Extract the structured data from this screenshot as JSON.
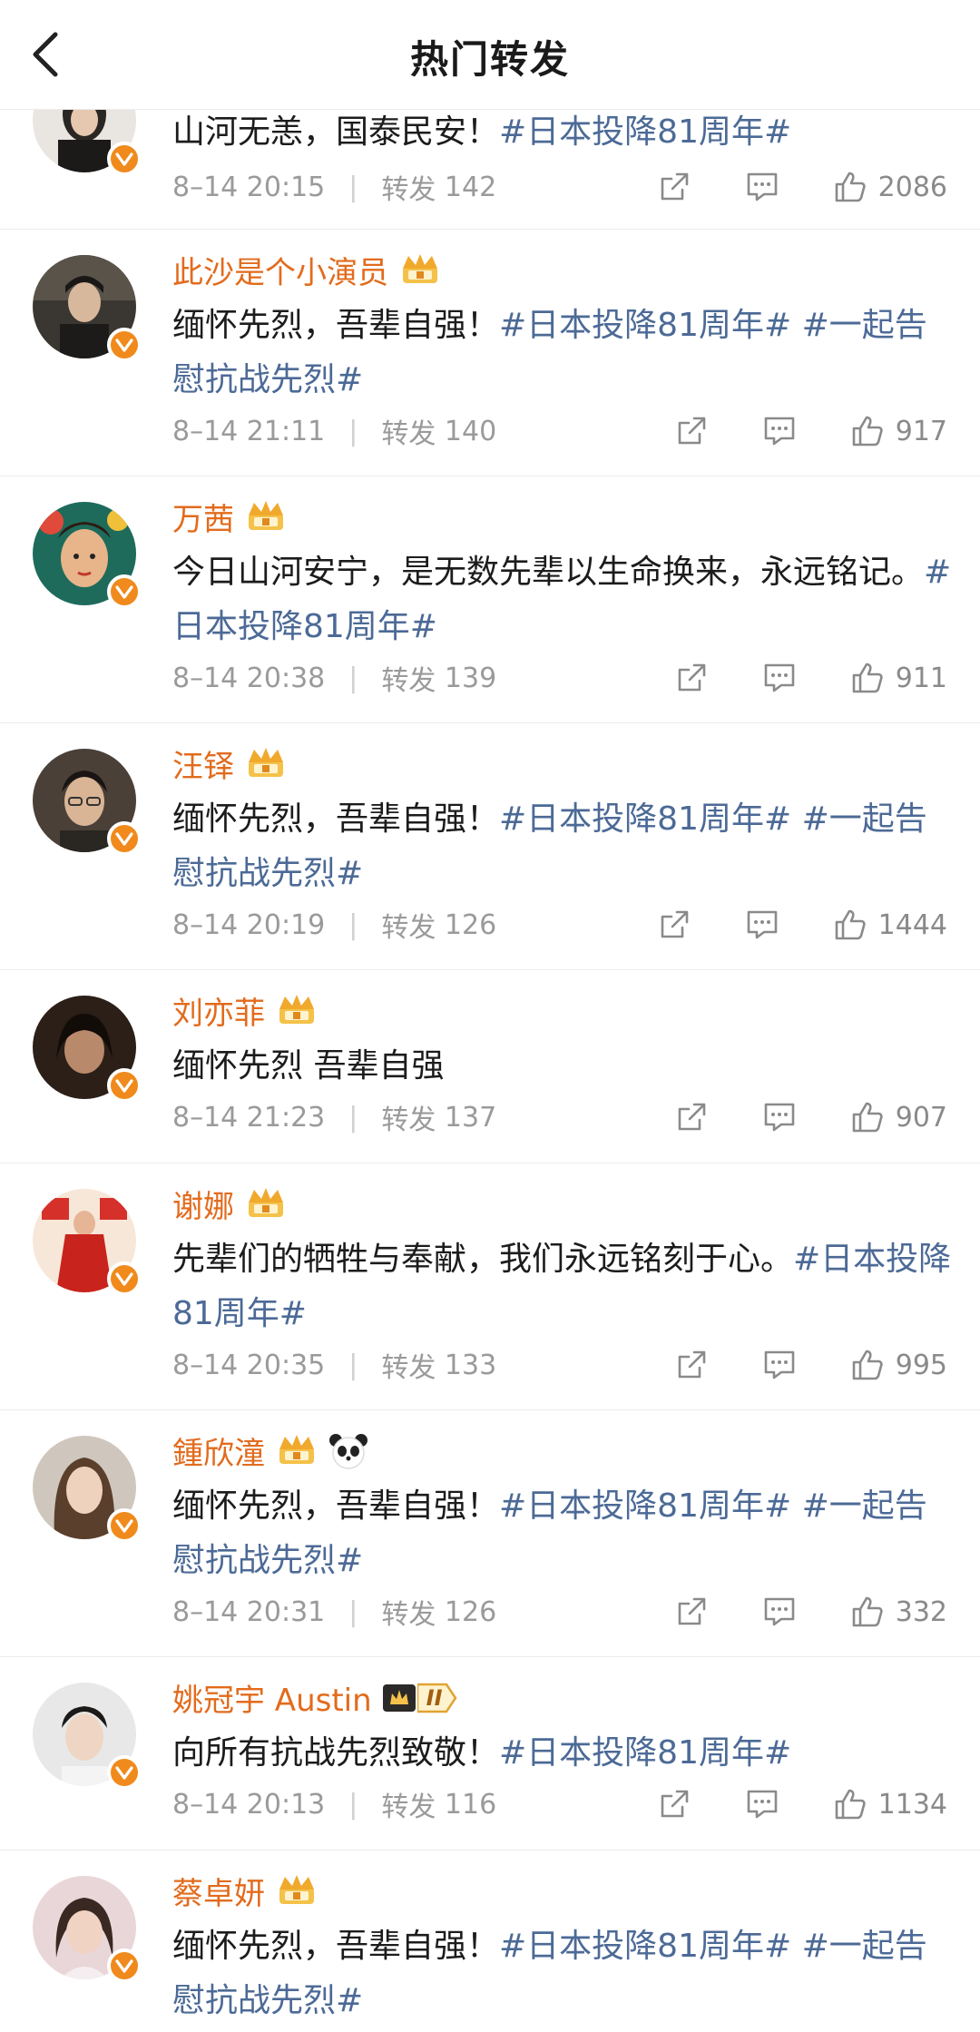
{
  "header": {
    "title": "热门转发"
  },
  "posts": [
    {
      "name": "",
      "badges": [],
      "text": "山河无恙，国泰民安！",
      "tags": "#日本投降81周年#",
      "time": "8–14 20:15",
      "repost_label": "转发",
      "repost_count": "142",
      "likes": "2086"
    },
    {
      "name": "此沙是个小演员",
      "badges": [
        "crown"
      ],
      "text": "缅怀先烈，吾辈自强！",
      "tags": "#日本投降81周年# #一起告慰抗战先烈#",
      "time": "8–14 21:11",
      "repost_label": "转发",
      "repost_count": "140",
      "likes": "917"
    },
    {
      "name": "万茜",
      "badges": [
        "crown"
      ],
      "text": "今日山河安宁，是无数先辈以生命换来，永远铭记。",
      "tags": "#日本投降81周年#",
      "time": "8–14 20:38",
      "repost_label": "转发",
      "repost_count": "139",
      "likes": "911"
    },
    {
      "name": "汪铎",
      "badges": [
        "crown"
      ],
      "text": "缅怀先烈，吾辈自强！",
      "tags": "#日本投降81周年# #一起告慰抗战先烈#",
      "time": "8–14 20:19",
      "repost_label": "转发",
      "repost_count": "126",
      "likes": "1444"
    },
    {
      "name": "刘亦菲",
      "badges": [
        "crown"
      ],
      "text": "缅怀先烈 吾辈自强",
      "tags": "",
      "time": "8–14 21:23",
      "repost_label": "转发",
      "repost_count": "137",
      "likes": "907"
    },
    {
      "name": "谢娜",
      "badges": [
        "crown"
      ],
      "text": "先辈们的牺牲与奉献，我们永远铭刻于心。",
      "tags": "#日本投降81周年#",
      "time": "8–14 20:35",
      "repost_label": "转发",
      "repost_count": "133",
      "likes": "995"
    },
    {
      "name": "鍾欣潼",
      "badges": [
        "crown",
        "panda"
      ],
      "text": "缅怀先烈，吾辈自强！",
      "tags": "#日本投降81周年# #一起告慰抗战先烈#",
      "time": "8–14 20:31",
      "repost_label": "转发",
      "repost_count": "126",
      "likes": "332"
    },
    {
      "name": "姚冠宇 Austin",
      "badges": [
        "rank"
      ],
      "rank_label": "II",
      "text": "向所有抗战先烈致敬！",
      "tags": "#日本投降81周年#",
      "time": "8–14 20:13",
      "repost_label": "转发",
      "repost_count": "116",
      "likes": "1134"
    },
    {
      "name": "蔡卓妍",
      "badges": [
        "crown"
      ],
      "text": "缅怀先烈，吾辈自强！",
      "tags": "#日本投降81周年# #一起告慰抗战先烈#",
      "time": "",
      "repost_label": "转发",
      "repost_count": "",
      "likes": ""
    }
  ],
  "colors": {
    "name": "#e26b1d",
    "tag": "#4c6a96",
    "meta": "#9a9a9a",
    "verified": "#f08a1c"
  },
  "icons": {
    "back": "chevron-left-icon",
    "share": "share-icon",
    "comment": "comment-icon",
    "like": "thumbs-up-icon",
    "verified": "verified-badge-icon",
    "crown": "crown-icon"
  }
}
